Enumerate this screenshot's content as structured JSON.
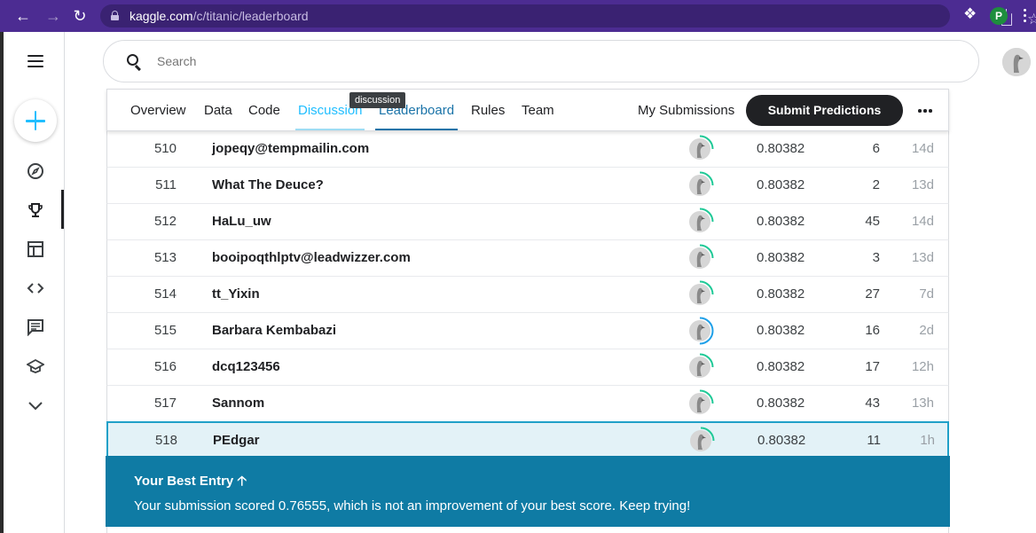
{
  "browser": {
    "url_host": "kaggle.com",
    "url_path": "/c/titanic/leaderboard",
    "profile_initial": "P"
  },
  "header": {
    "search_placeholder": "Search"
  },
  "tabs": [
    {
      "label": "Overview"
    },
    {
      "label": "Data"
    },
    {
      "label": "Code"
    },
    {
      "label": "Discussion"
    },
    {
      "label": "Leaderboard"
    },
    {
      "label": "Rules"
    },
    {
      "label": "Team"
    }
  ],
  "tooltip": "discussion",
  "actions": {
    "my_submissions": "My Submissions",
    "submit": "Submit Predictions"
  },
  "leaderboard": [
    {
      "rank": "510",
      "team": "jopeqy@tempmailin.com",
      "score": "0.80382",
      "entries": "6",
      "last": "14d",
      "ring": 0.25
    },
    {
      "rank": "511",
      "team": "What The Deuce?",
      "score": "0.80382",
      "entries": "2",
      "last": "13d",
      "ring": 0.25
    },
    {
      "rank": "512",
      "team": "HaLu_uw",
      "score": "0.80382",
      "entries": "45",
      "last": "14d",
      "ring": 0.25
    },
    {
      "rank": "513",
      "team": "booipoqthlptv@leadwizzer.com",
      "score": "0.80382",
      "entries": "3",
      "last": "13d",
      "ring": 0.25
    },
    {
      "rank": "514",
      "team": "tt_Yixin",
      "score": "0.80382",
      "entries": "27",
      "last": "7d",
      "ring": 0.25
    },
    {
      "rank": "515",
      "team": "Barbara Kembabazi",
      "score": "0.80382",
      "entries": "16",
      "last": "2d",
      "ring": 0.5
    },
    {
      "rank": "516",
      "team": "dcq123456",
      "score": "0.80382",
      "entries": "17",
      "last": "12h",
      "ring": 0.25
    },
    {
      "rank": "517",
      "team": "Sannom",
      "score": "0.80382",
      "entries": "43",
      "last": "13h",
      "ring": 0.25
    },
    {
      "rank": "518",
      "team": "PEdgar",
      "score": "0.80382",
      "entries": "11",
      "last": "1h",
      "ring": 0.25
    }
  ],
  "banner": {
    "title": "Your Best Entry",
    "message": "Your submission scored 0.76555, which is not an improvement of your best score. Keep trying!"
  },
  "colors": {
    "browser_bar": "#4c2c92",
    "accent": "#20beff",
    "banner": "#0f7ba4",
    "highlight_row": "#e3f2f7",
    "ring_green": "#20c997",
    "ring_blue": "#20a0e8"
  }
}
